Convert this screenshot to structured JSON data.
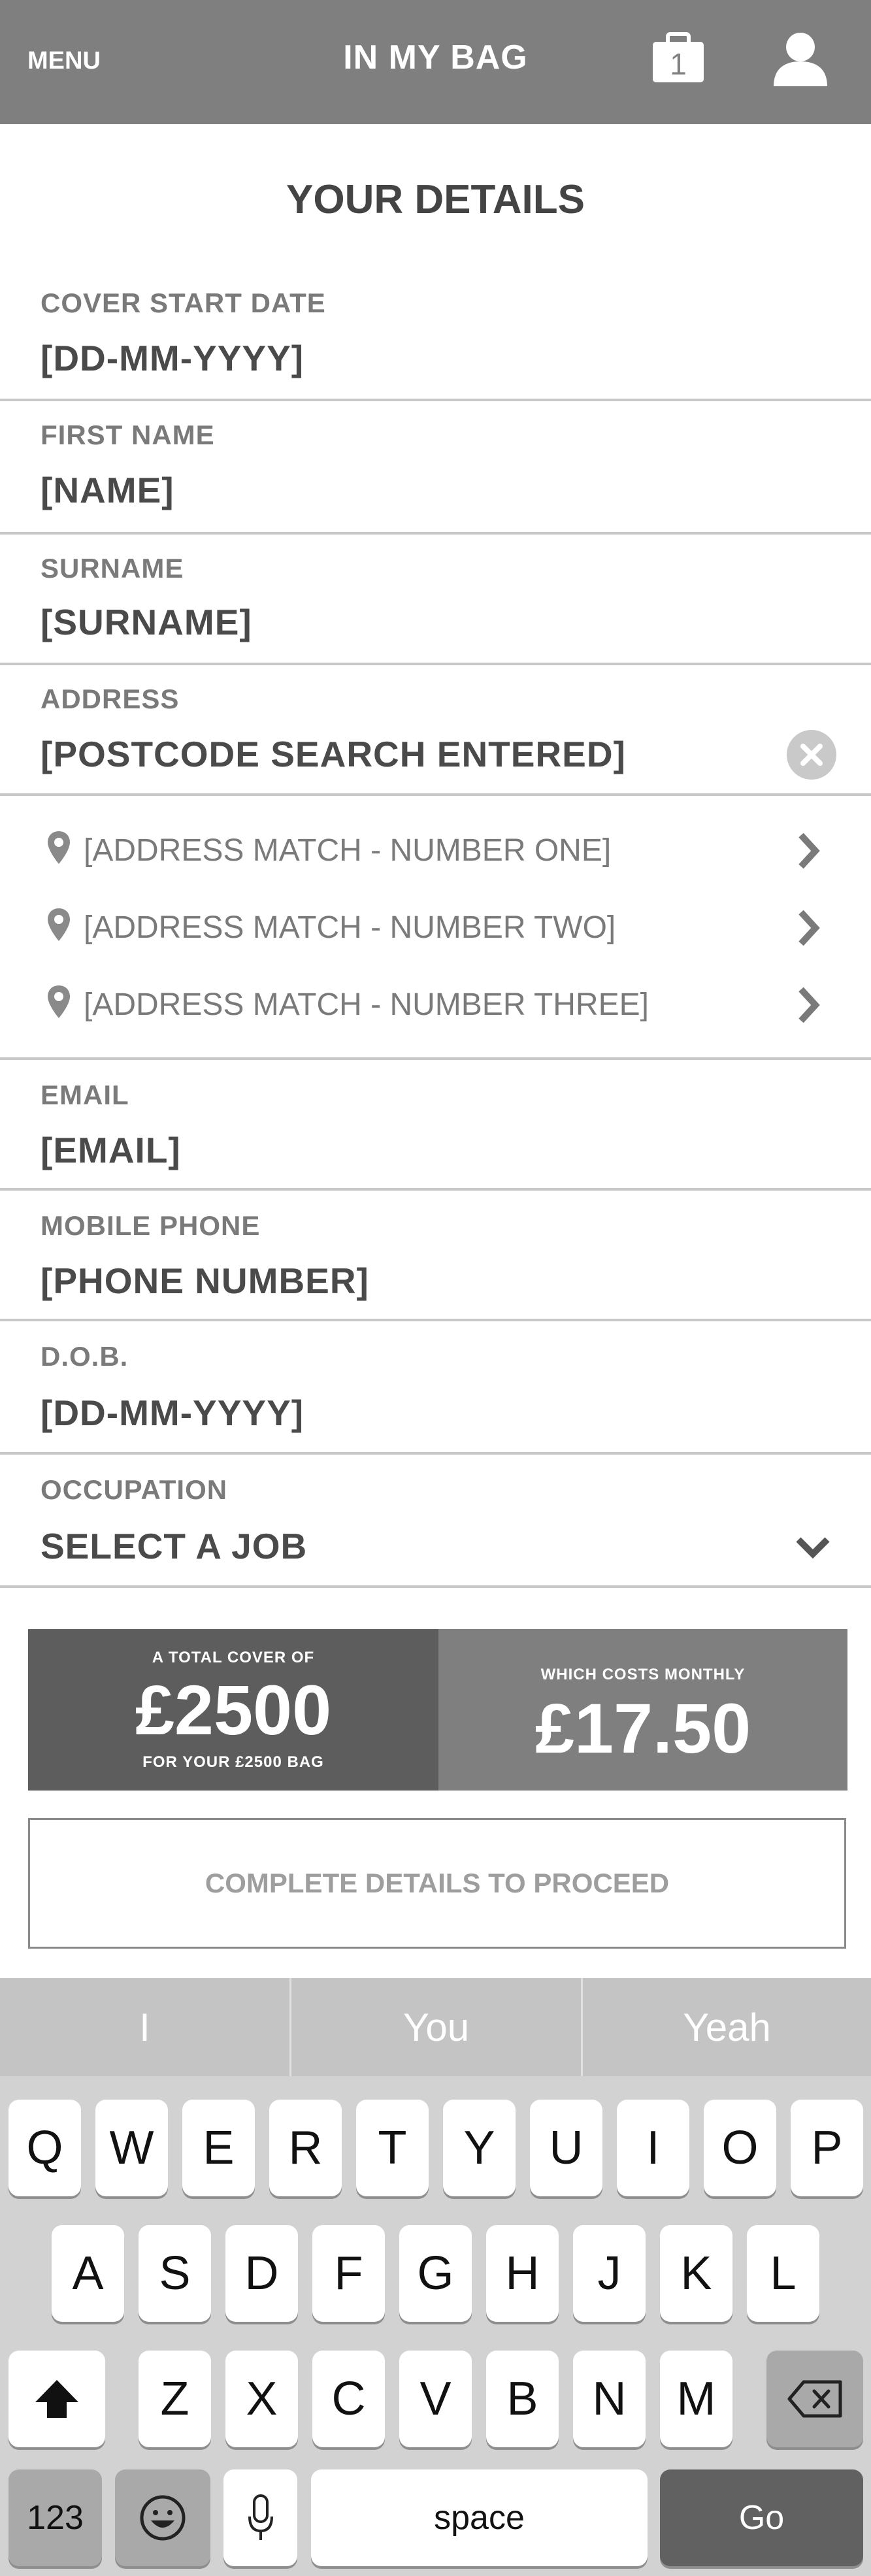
{
  "header": {
    "menu_label": "MENU",
    "title": "IN MY BAG",
    "bag_count": "1"
  },
  "section_title": "YOUR DETAILS",
  "fields": {
    "cover_start": {
      "label": "COVER START DATE",
      "value": "[DD-MM-YYYY]"
    },
    "first_name": {
      "label": "FIRST NAME",
      "value": "[NAME]"
    },
    "surname": {
      "label": "SURNAME",
      "value": "[SURNAME]"
    },
    "address": {
      "label": "ADDRESS",
      "value": "[POSTCODE SEARCH ENTERED]"
    },
    "email": {
      "label": "EMAIL",
      "value": "[EMAIL]"
    },
    "mobile": {
      "label": "MOBILE PHONE",
      "value": "[PHONE NUMBER]"
    },
    "dob": {
      "label": "D.O.B.",
      "value": "[DD-MM-YYYY]"
    },
    "occupation": {
      "label": "OCCUPATION",
      "value": "SELECT A JOB"
    }
  },
  "address_matches": [
    "[ADDRESS MATCH - NUMBER ONE]",
    "[ADDRESS MATCH - NUMBER TWO]",
    "[ADDRESS MATCH - NUMBER THREE]"
  ],
  "summary": {
    "cover_top": "A TOTAL COVER OF",
    "cover_amount": "£2500",
    "cover_bottom": "FOR YOUR £2500 BAG",
    "cost_top": "WHICH COSTS MONTHLY",
    "cost_amount": "£17.50"
  },
  "proceed_label": "COMPLETE DETAILS TO PROCEED",
  "keyboard": {
    "suggestions": [
      "I",
      "You",
      "Yeah"
    ],
    "row1": [
      "Q",
      "W",
      "E",
      "R",
      "T",
      "Y",
      "U",
      "I",
      "O",
      "P"
    ],
    "row2": [
      "A",
      "S",
      "D",
      "F",
      "G",
      "H",
      "J",
      "K",
      "L"
    ],
    "row3": [
      "Z",
      "X",
      "C",
      "V",
      "B",
      "N",
      "M"
    ],
    "numbers_label": "123",
    "space_label": "space",
    "go_label": "Go"
  },
  "colors": {
    "header_bg": "#7f7f7f",
    "summary_left_bg": "#5d5d5d",
    "summary_right_bg": "#7f7f7f",
    "keyboard_bg": "#d2d2d2"
  }
}
